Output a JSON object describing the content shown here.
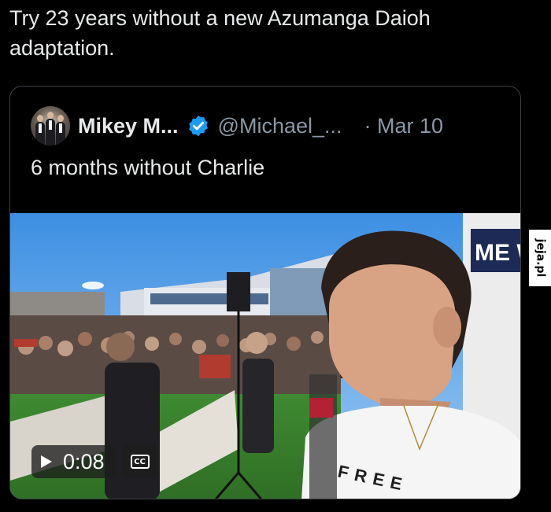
{
  "post": {
    "text": "Try 23 years without a new Azumanga Daioh adaptation."
  },
  "quoted_post": {
    "author_name": "Mikey M...",
    "verified_icon": "verified-badge-icon",
    "handle": "@Michael_...",
    "date_separator": "·",
    "date": "Mar 10",
    "text": "6 months without Charlie"
  },
  "video": {
    "duration": "0:08",
    "play_icon": "play-icon",
    "cc_label": "CC",
    "shirt_text": "FREE",
    "sign_text": "ME W"
  },
  "watermark": {
    "text": "jeja.pl"
  },
  "colors": {
    "background": "#000000",
    "text": "#e7e9ea",
    "secondary_text": "#8b98a5",
    "verified_blue": "#1d9bf0",
    "card_border": "#3b4045"
  }
}
